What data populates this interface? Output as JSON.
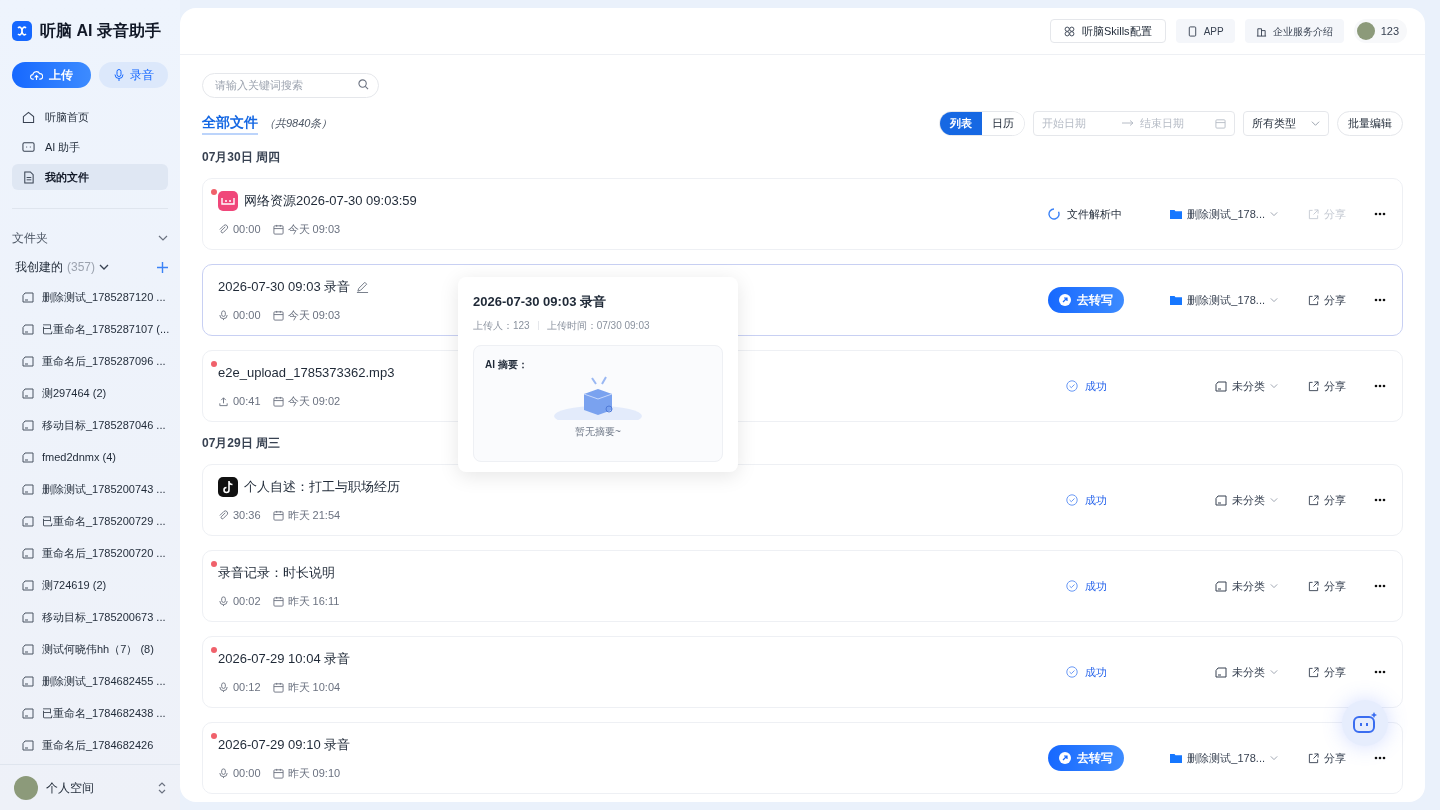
{
  "app_title": "听脑 AI 录音助手",
  "actions": [
    {
      "label": "上传",
      "kind": "primary"
    },
    {
      "label": "录音",
      "kind": "secondary"
    }
  ],
  "nav": [
    {
      "label": "听脑首页",
      "selected": false
    },
    {
      "label": "AI 助手",
      "selected": false
    },
    {
      "label": "我的文件",
      "selected": true
    }
  ],
  "folders_header": "文件夹",
  "my_created": {
    "label": "我创建的",
    "count": "(357)"
  },
  "folders": [
    "删除测试_1785287120 ...",
    "已重命名_1785287107 (...",
    "重命名后_1785287096 ...",
    "测297464 (2)",
    "移动目标_1785287046 ...",
    "fmed2dnmx (4)",
    "删除测试_1785200743 ...",
    "已重命名_1785200729 ...",
    "重命名后_1785200720 ...",
    "测724619 (2)",
    "移动目标_1785200673 ...",
    "测试何晓伟hh（7） (8)",
    "删除测试_1784682455 ...",
    "已重命名_1784682438 ...",
    "重命名后_1784682426"
  ],
  "space": "个人空间",
  "top_buttons": [
    {
      "label": "听脑Skills配置",
      "kind": "skills"
    },
    {
      "label": "APP",
      "kind": "app"
    },
    {
      "label": "企业服务介绍",
      "kind": "enterprise"
    }
  ],
  "user": "123",
  "search": {
    "placeholder": "请输入关键词搜索"
  },
  "heading": "全部文件",
  "total": "（共9840条）",
  "views": [
    {
      "label": "列表",
      "selected": true
    },
    {
      "label": "日历",
      "selected": false
    }
  ],
  "date_range": {
    "start_placeholder": "开始日期",
    "end_placeholder": "结束日期"
  },
  "type_filter": "所有类型",
  "batch_edit": "批量编辑",
  "groups": [
    {
      "date": "07月30日 周四",
      "items": [
        {
          "title": "网络资源2026-07-30 09:03:59",
          "unread": true,
          "kind": "pink-app",
          "editable": false,
          "hovered": false,
          "duration": {
            "kind": "link",
            "text": "00:00"
          },
          "time": "今天 09:03",
          "status": {
            "kind": "parsing",
            "label": "文件解析中"
          },
          "folder": {
            "kind": "folder",
            "label": "删除测试_178..."
          },
          "share": {
            "label": "分享",
            "disabled": true
          }
        },
        {
          "title": "2026-07-30 09:03 录音",
          "unread": false,
          "kind": "plain",
          "editable": true,
          "hovered": true,
          "duration": {
            "kind": "mic",
            "text": "00:00"
          },
          "time": "今天 09:03",
          "status": {
            "kind": "transcribe",
            "label": "去转写"
          },
          "folder": {
            "kind": "folder",
            "label": "删除测试_178..."
          },
          "share": {
            "label": "分享",
            "disabled": false
          }
        },
        {
          "title": "e2e_upload_1785373362.mp3",
          "unread": true,
          "kind": "plain",
          "editable": false,
          "hovered": false,
          "duration": {
            "kind": "upload",
            "text": "00:41"
          },
          "time": "今天 09:02",
          "status": {
            "kind": "success",
            "label": "成功"
          },
          "folder": {
            "kind": "unclassified",
            "label": "未分类"
          },
          "share": {
            "label": "分享",
            "disabled": false
          }
        }
      ]
    },
    {
      "date": "07月29日 周三",
      "items": [
        {
          "title": "个人自述：打工与职场经历",
          "unread": false,
          "kind": "music-app",
          "editable": false,
          "hovered": false,
          "duration": {
            "kind": "link",
            "text": "30:36"
          },
          "time": "昨天 21:54",
          "status": {
            "kind": "success",
            "label": "成功"
          },
          "folder": {
            "kind": "unclassified",
            "label": "未分类"
          },
          "share": {
            "label": "分享",
            "disabled": false
          }
        },
        {
          "title": "录音记录：时长说明",
          "unread": true,
          "kind": "plain",
          "editable": false,
          "hovered": false,
          "duration": {
            "kind": "mic",
            "text": "00:02"
          },
          "time": "昨天 16:11",
          "status": {
            "kind": "success",
            "label": "成功"
          },
          "folder": {
            "kind": "unclassified",
            "label": "未分类"
          },
          "share": {
            "label": "分享",
            "disabled": false
          }
        },
        {
          "title": "2026-07-29 10:04 录音",
          "unread": true,
          "kind": "plain",
          "editable": false,
          "hovered": false,
          "duration": {
            "kind": "mic",
            "text": "00:12"
          },
          "time": "昨天 10:04",
          "status": {
            "kind": "success",
            "label": "成功"
          },
          "folder": {
            "kind": "unclassified",
            "label": "未分类"
          },
          "share": {
            "label": "分享",
            "disabled": false
          }
        },
        {
          "title": "2026-07-29 09:10 录音",
          "unread": true,
          "kind": "plain",
          "editable": false,
          "hovered": false,
          "duration": {
            "kind": "mic",
            "text": "00:00"
          },
          "time": "昨天 09:10",
          "status": {
            "kind": "transcribe",
            "label": "去转写"
          },
          "folder": {
            "kind": "folder",
            "label": "删除测试_178..."
          },
          "share": {
            "label": "分享",
            "disabled": false
          }
        }
      ]
    }
  ],
  "popover": {
    "title": "2026-07-30 09:03 录音",
    "uploader": "上传人：123",
    "upload_time": "上传时间：07/30 09:03",
    "summary_label": "AI 摘要：",
    "empty": "暂无摘要~"
  }
}
